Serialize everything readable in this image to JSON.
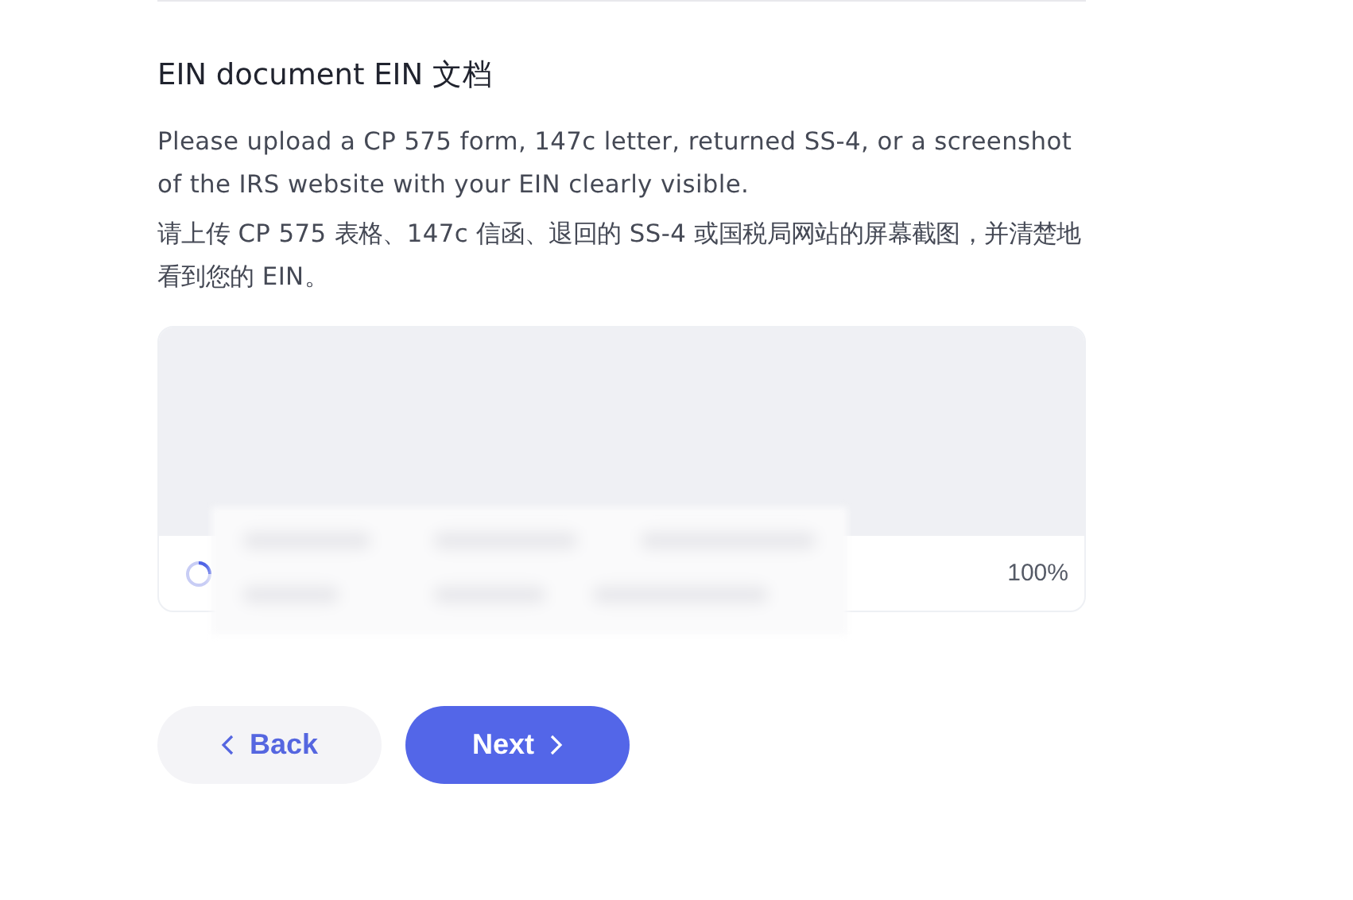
{
  "section": {
    "title": "EIN document EIN 文档",
    "description": "Please upload a CP 575 form, 147c letter, returned SS-4, or a screenshot of the IRS website with your EIN clearly visible.",
    "description_zh": "请上传 CP 575 表格、147c 信函、退回的 SS-4 或国税局网站的屏幕截图，并清楚地看到您的 EIN。"
  },
  "upload": {
    "loading": true,
    "progress": "100%",
    "redacted": true
  },
  "buttons": [
    {
      "kind": "back",
      "label": "Back"
    },
    {
      "kind": "next",
      "label": "Next"
    }
  ]
}
